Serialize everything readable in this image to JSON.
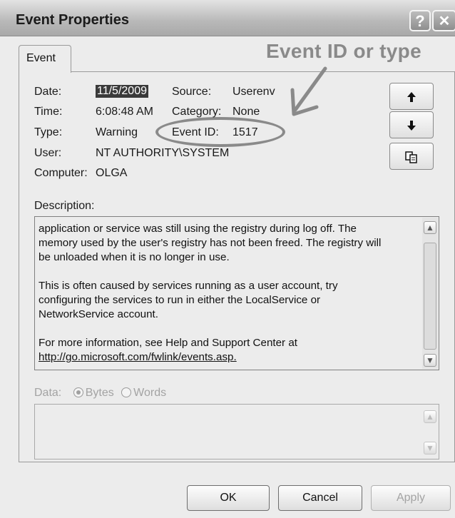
{
  "window": {
    "title": "Event Properties",
    "help_button": "?",
    "close_button": "✕"
  },
  "tabs": [
    {
      "label": "Event"
    }
  ],
  "annotation": {
    "text": "Event ID or type",
    "color": "#8a8a8a"
  },
  "fields": {
    "date_label": "Date:",
    "date_value": "11/5/2009",
    "source_label": "Source:",
    "source_value": "Userenv",
    "time_label": "Time:",
    "time_value": "6:08:48 AM",
    "category_label": "Category:",
    "category_value": "None",
    "type_label": "Type:",
    "type_value": "Warning",
    "event_id_label": "Event ID:",
    "event_id_value": "1517",
    "user_label": "User:",
    "user_value": "NT AUTHORITY\\SYSTEM",
    "computer_label": "Computer:",
    "computer_value": "OLGA"
  },
  "side_buttons": {
    "up_icon": "arrow-up-icon",
    "down_icon": "arrow-down-icon",
    "copy_icon": "copy-icon"
  },
  "description": {
    "label": "Description:",
    "lines": [
      "application or service was still using the registry during log off. The",
      "memory used by the user's registry has not been freed. The registry will",
      "be unloaded when it is no longer in use.",
      "",
      " This is often caused by services running as a user account, try",
      "configuring the services to run in either the LocalService or",
      "NetworkService account.",
      "",
      "For more information, see Help and Support Center at",
      "http://go.microsoft.com/fwlink/events.asp."
    ]
  },
  "data_section": {
    "label": "Data:",
    "options": [
      "Bytes",
      "Words"
    ],
    "selected": "Bytes"
  },
  "buttons": {
    "ok": "OK",
    "cancel": "Cancel",
    "apply": "Apply"
  }
}
